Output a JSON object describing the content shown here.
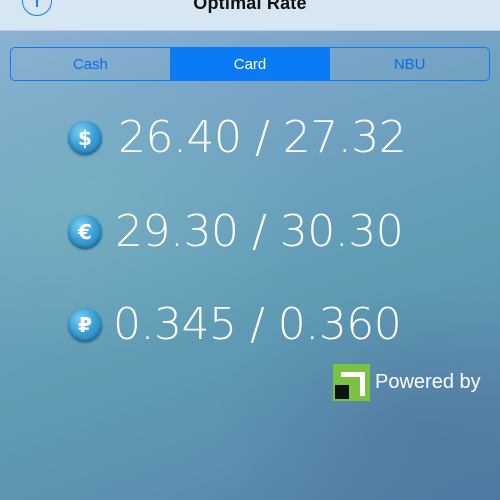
{
  "nav": {
    "title": "Optimal Rate",
    "info_icon": "info-circle-icon"
  },
  "segments": {
    "items": [
      {
        "label": "Cash",
        "selected": false
      },
      {
        "label": "Card",
        "selected": true
      },
      {
        "label": "NBU",
        "selected": false
      }
    ]
  },
  "rates": [
    {
      "currency_icon": "dollar-coin-icon",
      "symbol": "$",
      "value": "26.40 / 27.32"
    },
    {
      "currency_icon": "euro-coin-icon",
      "symbol": "€",
      "value": "29.30 / 30.30"
    },
    {
      "currency_icon": "ruble-coin-icon",
      "symbol": "₽",
      "value": "0.345 / 0.360"
    }
  ],
  "footer": {
    "powered_label": "Powered by",
    "logo_icon": "privatbank-logo-icon"
  },
  "colors": {
    "accent": "#0a7bf5",
    "logo_green": "#7bc142",
    "text_light": "#ffffff"
  }
}
